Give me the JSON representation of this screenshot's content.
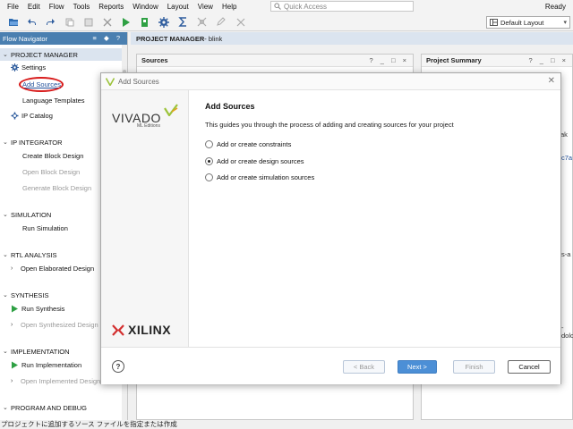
{
  "menubar": {
    "items": [
      "File",
      "Edit",
      "Flow",
      "Tools",
      "Reports",
      "Window",
      "Layout",
      "View",
      "Help"
    ],
    "quick_access_placeholder": "Quick Access",
    "status": "Ready"
  },
  "toolbar": {
    "layout_select": "Default Layout"
  },
  "flow_navigator": {
    "title": "Flow Navigator",
    "header_controls": "≡ ◆ ?",
    "sections": {
      "project_manager": "PROJECT MANAGER",
      "ip_integrator": "IP INTEGRATOR",
      "simulation": "SIMULATION",
      "rtl_analysis": "RTL ANALYSIS",
      "synthesis": "SYNTHESIS",
      "implementation": "IMPLEMENTATION",
      "program_and_debug": "PROGRAM AND DEBUG"
    },
    "items": {
      "settings": "Settings",
      "add_sources": "Add Sources",
      "language_templates": "Language Templates",
      "ip_catalog": "IP Catalog",
      "create_block_design": "Create Block Design",
      "open_block_design": "Open Block Design",
      "generate_block_design": "Generate Block Design",
      "run_simulation": "Run Simulation",
      "open_elaborated_design": "Open Elaborated Design",
      "run_synthesis": "Run Synthesis",
      "open_synthesized_design": "Open Synthesized Design",
      "run_implementation": "Run Implementation",
      "open_implemented_design": "Open Implemented Design"
    }
  },
  "workspace": {
    "header_title": "PROJECT MANAGER",
    "header_project": " - blink",
    "sources_panel_title": "Sources",
    "summary_panel_title": "Project Summary",
    "panel_controls": "? _ □ ×",
    "peek_texts": [
      "ak",
      "c7a",
      "s-a",
      "-dolc"
    ]
  },
  "status_bar": {
    "text": "プロジェクトに追加するソース ファイルを指定または作成"
  },
  "dialog": {
    "window_title": "Add Sources",
    "heading": "Add Sources",
    "description": "This guides you through the process of adding and creating sources for your project",
    "options": [
      {
        "label": "Add or create constraints",
        "selected": false
      },
      {
        "label": "Add or create design sources",
        "selected": true
      },
      {
        "label": "Add or create simulation sources",
        "selected": false
      }
    ],
    "vivado_logo_text": "VIVADO",
    "vivado_edition": "ML Editions",
    "xilinx_text": "XILINX",
    "help_label": "?",
    "buttons": {
      "back": "< Back",
      "next": "Next >",
      "finish": "Finish",
      "cancel": "Cancel"
    },
    "colors": {
      "primary_button": "#4c8fd6",
      "vivado_accent": "#9cc33b",
      "xilinx_red": "#d32f2f",
      "highlight_circle": "#d81c1c"
    }
  }
}
